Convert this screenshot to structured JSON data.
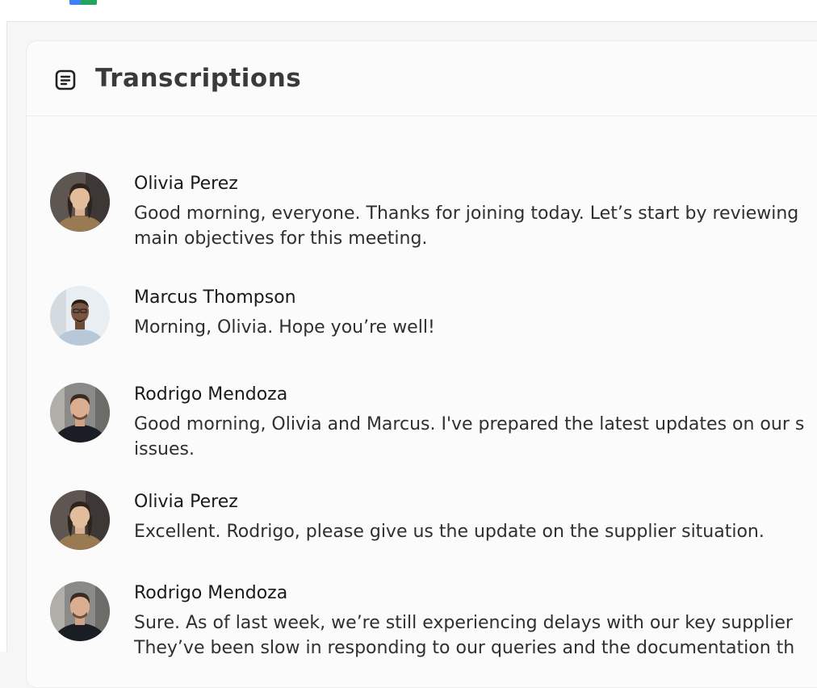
{
  "header": {
    "title": "Transcriptions",
    "icon": "document-lines-icon"
  },
  "colors": {
    "background": "#f6f6f6",
    "card": "#fbfbfb",
    "border": "#ececec",
    "title": "#3a3a3a",
    "text": "#2f2f2f"
  },
  "transcript": [
    {
      "speaker": "Olivia Perez",
      "avatar": "avatar-olivia",
      "lines": [
        "Good morning, everyone. Thanks for joining today. Let’s start by reviewing",
        "main objectives for this meeting."
      ]
    },
    {
      "speaker": "Marcus Thompson",
      "avatar": "avatar-marcus",
      "lines": [
        "Morning, Olivia. Hope you’re well!"
      ]
    },
    {
      "speaker": "Rodrigo Mendoza",
      "avatar": "avatar-rodrigo",
      "lines": [
        "Good morning, Olivia and Marcus. I've prepared the latest updates on our s",
        "issues."
      ]
    },
    {
      "speaker": "Olivia Perez",
      "avatar": "avatar-olivia",
      "lines": [
        "Excellent. Rodrigo, please give us the update on the supplier situation."
      ]
    },
    {
      "speaker": "Rodrigo Mendoza",
      "avatar": "avatar-rodrigo",
      "lines": [
        "Sure. As of last week, we’re still experiencing delays with our key supplier",
        "They’ve been slow in responding to our queries and the documentation th"
      ]
    }
  ]
}
